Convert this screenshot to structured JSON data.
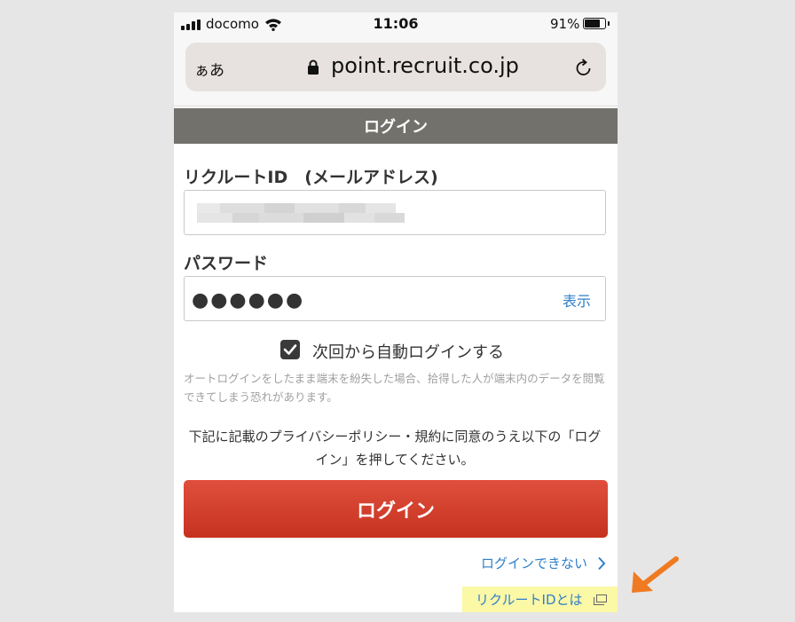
{
  "status_bar": {
    "carrier": "docomo",
    "time": "11:06",
    "battery_percent": "91%",
    "battery_level": 0.91
  },
  "browser": {
    "text_size_label": "ぁあ",
    "url": "point.recruit.co.jp"
  },
  "page": {
    "header_title": "ログイン",
    "id_label": "リクルートID　(メールアドレス)",
    "id_value_redacted": true,
    "password_label": "パスワード",
    "password_value": "●●●●●●",
    "show_password_label": "表示",
    "auto_login_label": "次回から自動ログインする",
    "auto_login_checked": true,
    "auto_login_note": "オートログインをしたまま端末を紛失した場合、拾得した人が端末内のデータを閲覧できてしまう恐れがあります。",
    "consent_text": "下記に記載のプライバシーポリシー・規約に同意のうえ以下の「ログイン」を押してください。",
    "login_button_label": "ログイン",
    "cannot_login_link": "ログインできない",
    "about_id_link": "リクルートIDとは"
  },
  "colors": {
    "header_bar": "#72716c",
    "login_button": "#d43f2c",
    "link": "#2f7fc9",
    "highlight": "#fbf8a6",
    "annotation_arrow": "#f07a22"
  },
  "icons": [
    "signal-icon",
    "wifi-icon",
    "battery-icon",
    "lock-icon",
    "reload-icon",
    "checkbox-checked-icon",
    "chevron-right-icon",
    "new-window-icon",
    "annotation-arrow-icon"
  ]
}
